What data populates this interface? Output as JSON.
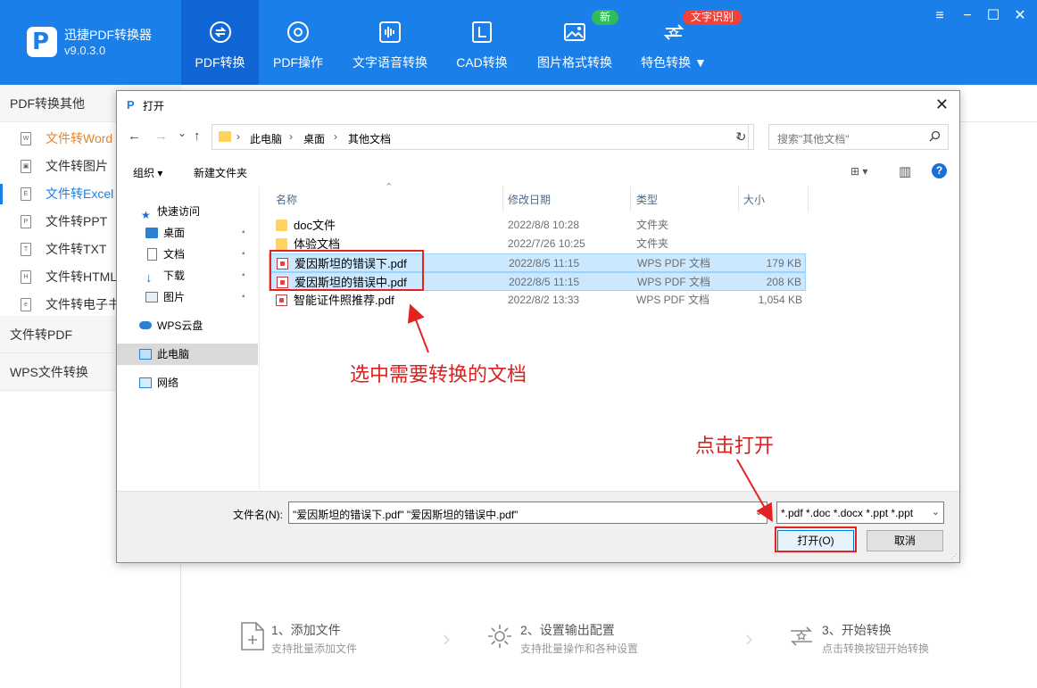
{
  "app": {
    "name": "迅捷PDF转换器",
    "version": "v9.0.3.0",
    "logo_letter": "P"
  },
  "nav_tabs": [
    {
      "label": "PDF转换",
      "icon": "refresh-icon",
      "active": true
    },
    {
      "label": "PDF操作",
      "icon": "gear-icon"
    },
    {
      "label": "文字语音转换",
      "icon": "audio-wave-icon"
    },
    {
      "label": "CAD转换",
      "icon": "cad-icon"
    },
    {
      "label": "图片格式转换",
      "icon": "image-icon",
      "badge": "新"
    },
    {
      "label": "特色转换 ▼",
      "icon": "feature-icon",
      "badge": "文字识别"
    }
  ],
  "window_controls": [
    "≡",
    "−",
    "☐",
    "✕"
  ],
  "sidebar": {
    "sections": [
      "PDF转换其他",
      "文件转PDF",
      "WPS文件转换"
    ],
    "items": [
      {
        "label": "文件转Word",
        "icon": "W"
      },
      {
        "label": "文件转图片",
        "icon": "▣"
      },
      {
        "label": "文件转Excel",
        "icon": "E"
      },
      {
        "label": "文件转PPT",
        "icon": "P"
      },
      {
        "label": "文件转TXT",
        "icon": "T"
      },
      {
        "label": "文件转HTML",
        "icon": "H"
      },
      {
        "label": "文件转电子书",
        "icon": "e"
      }
    ]
  },
  "steps": [
    {
      "title": "1、添加文件",
      "subtitle": "支持批量添加文件"
    },
    {
      "title": "2、设置输出配置",
      "subtitle": "支持批量操作和各种设置"
    },
    {
      "title": "3、开始转换",
      "subtitle": "点击转换按钮开始转换"
    }
  ],
  "dialog": {
    "icon_letter": "P",
    "title": "打开",
    "close": "✕",
    "nav": {
      "back": "←",
      "forward": "→",
      "recent": "⌄",
      "up": "↑",
      "refresh": "↻",
      "dropdown": "⌄"
    },
    "breadcrumb": [
      "此电脑",
      "桌面",
      "其他文档"
    ],
    "search_placeholder": "搜索\"其他文档\"",
    "toolbar": {
      "organize": "组织 ▾",
      "new_folder": "新建文件夹",
      "view": "⊞ ▾",
      "pane": "▥",
      "help": "?"
    },
    "navpane": [
      {
        "label": "快速访问",
        "icon": "star-icon"
      },
      {
        "label": "桌面",
        "icon": "desktop-icon",
        "pinned": true
      },
      {
        "label": "文档",
        "icon": "document-icon",
        "pinned": true
      },
      {
        "label": "下载",
        "icon": "download-icon",
        "pinned": true
      },
      {
        "label": "图片",
        "icon": "pictures-icon",
        "pinned": true
      },
      {
        "label": "WPS云盘",
        "icon": "cloud-icon"
      },
      {
        "label": "此电脑",
        "icon": "computer-icon"
      },
      {
        "label": "网络",
        "icon": "network-icon"
      }
    ],
    "pin_glyph": "📌",
    "columns": {
      "name": "名称",
      "date": "修改日期",
      "type": "类型",
      "size": "大小",
      "sort": "⌃"
    },
    "files": [
      {
        "name": "doc文件",
        "date": "2022/8/8 10:28",
        "type": "文件夹",
        "size": "",
        "kind": "folder"
      },
      {
        "name": "体验文档",
        "date": "2022/7/26 10:25",
        "type": "文件夹",
        "size": "",
        "kind": "folder"
      },
      {
        "name": "爱因斯坦的错误下.pdf",
        "date": "2022/8/5 11:15",
        "type": "WPS PDF 文档",
        "size": "179 KB",
        "kind": "pdf",
        "selected": true
      },
      {
        "name": "爱因斯坦的错误中.pdf",
        "date": "2022/8/5 11:15",
        "type": "WPS PDF 文档",
        "size": "208 KB",
        "kind": "pdf",
        "selected": true
      },
      {
        "name": "智能证件照推荐.pdf",
        "date": "2022/8/2 13:33",
        "type": "WPS PDF 文档",
        "size": "1,054 KB",
        "kind": "pdf"
      }
    ],
    "filename_label": "文件名(N):",
    "filename_value": "\"爱因斯坦的错误下.pdf\" \"爱因斯坦的错误中.pdf\"",
    "filetype_value": "*.pdf *.doc *.docx *.ppt *.ppt",
    "open_label": "打开(O)",
    "cancel_label": "取消"
  },
  "annotations": {
    "select_hint": "选中需要转换的文档",
    "click_hint": "点击打开"
  },
  "colors": {
    "brand": "#1a7fe8",
    "active_tab": "#1066d4",
    "annotation": "#e52222",
    "selection": "#cce8ff"
  }
}
